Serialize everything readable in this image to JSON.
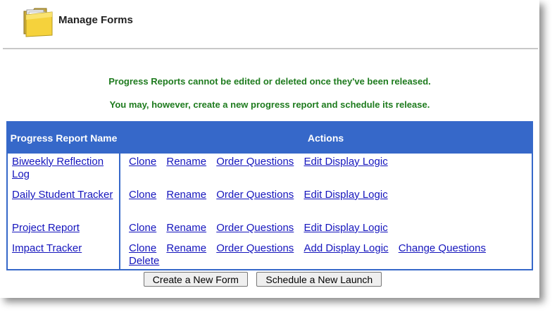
{
  "header": {
    "title": "Manage Forms",
    "icon": "folder-icon"
  },
  "notices": [
    "Progress Reports cannot be edited or deleted once they've been released.",
    "You may, however, create a new progress report and schedule its release."
  ],
  "colors": {
    "table_header": "#3668c9",
    "notice_text": "#1e7b1e",
    "link": "#1515bd"
  },
  "table": {
    "headers": {
      "name": "Progress Report Name",
      "actions": "Actions"
    },
    "rows": [
      {
        "name": "Biweekly Reflection Log",
        "actions": [
          "Clone",
          "Rename",
          "Order Questions",
          "Edit Display Logic"
        ]
      },
      {
        "name": "Daily Student Tracker",
        "actions": [
          "Clone",
          "Rename",
          "Order Questions",
          "Edit Display Logic"
        ]
      },
      {
        "name": "Project Report",
        "actions": [
          "Clone",
          "Rename",
          "Order Questions",
          "Edit Display Logic"
        ]
      },
      {
        "name": "Impact Tracker",
        "actions": [
          "Clone",
          "Rename",
          "Order Questions",
          "Add Display Logic",
          "Change Questions",
          "Delete"
        ]
      }
    ]
  },
  "buttons": {
    "create": "Create a New Form",
    "schedule": "Schedule a New Launch"
  }
}
